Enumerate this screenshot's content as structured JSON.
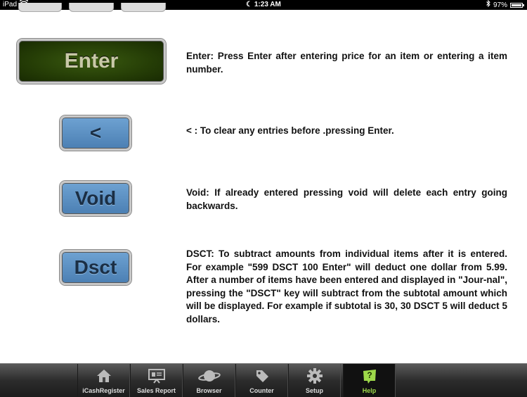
{
  "status_bar": {
    "device": "iPad",
    "time": "1:23 AM",
    "battery": "97%",
    "battery_level": 0.97
  },
  "keys": [
    {
      "label": "Enter",
      "description": "Enter:  Press Enter after entering price for an item or entering a item number."
    },
    {
      "label": "<",
      "description": "< :  To clear any entries before .pressing Enter."
    },
    {
      "label": "Void",
      "description": "Void:  If already entered pressing void will delete each entry going backwards."
    },
    {
      "label": "Dsct",
      "description": "DSCT:  To subtract amounts from individual items after it is entered. For example \"599 DSCT 100 Enter\" will deduct one dollar from 5.99. After a number of items have been entered and displayed in \"Jour-nal\", pressing the \"DSCT\" key will subtract from the subtotal amount which will be displayed. For example if subtotal is 30, 30 DSCT 5 will deduct 5 dollars."
    }
  ],
  "tab_bar": {
    "tabs": [
      {
        "label": "iCashRegister",
        "icon": "house-icon"
      },
      {
        "label": "Sales Report",
        "icon": "presentation-board-icon"
      },
      {
        "label": "Browser",
        "icon": "planet-icon"
      },
      {
        "label": "Counter",
        "icon": "price-tag-icon"
      },
      {
        "label": "Setup",
        "icon": "gear-icon"
      },
      {
        "label": "Help",
        "icon": "help-question-icon"
      }
    ],
    "active": "Help",
    "active_color": "#9ed94a"
  }
}
